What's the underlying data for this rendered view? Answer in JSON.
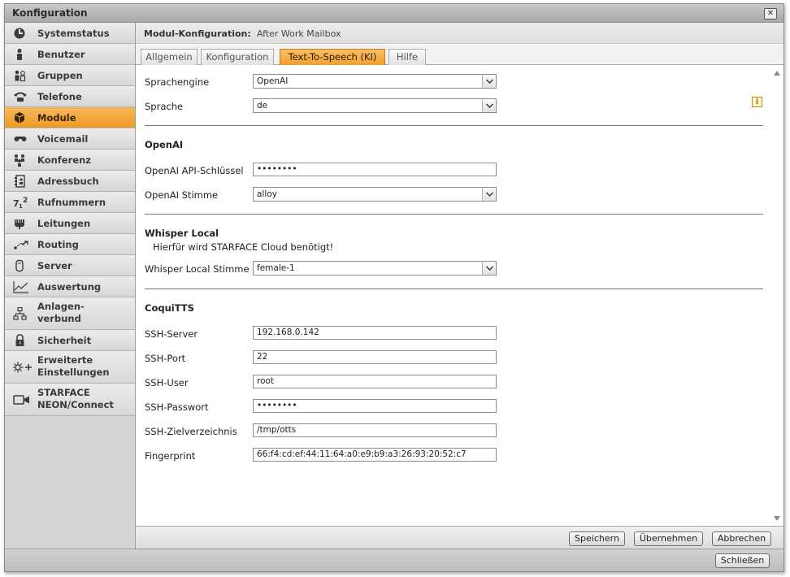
{
  "window": {
    "title": "Konfiguration",
    "close_label": "✕"
  },
  "sidebar": {
    "items": [
      {
        "label": "Systemstatus",
        "icon": "systemstatus-icon"
      },
      {
        "label": "Benutzer",
        "icon": "user-icon"
      },
      {
        "label": "Gruppen",
        "icon": "group-icon"
      },
      {
        "label": "Telefone",
        "icon": "phone-icon"
      },
      {
        "label": "Module",
        "icon": "module-icon",
        "active": true
      },
      {
        "label": "Voicemail",
        "icon": "voicemail-icon"
      },
      {
        "label": "Konferenz",
        "icon": "conference-icon"
      },
      {
        "label": "Adressbuch",
        "icon": "addressbook-icon"
      },
      {
        "label": "Rufnummern",
        "icon": "numbers-icon"
      },
      {
        "label": "Leitungen",
        "icon": "lines-icon"
      },
      {
        "label": "Routing",
        "icon": "routing-icon"
      },
      {
        "label": "Server",
        "icon": "server-icon"
      },
      {
        "label": "Auswertung",
        "icon": "chart-icon"
      },
      {
        "label": "Anlagen-\nverbund",
        "icon": "network-icon"
      },
      {
        "label": "Sicherheit",
        "icon": "lock-icon"
      },
      {
        "label": "Erweiterte\nEinstellungen",
        "icon": "advanced-settings-icon"
      },
      {
        "label": "STARFACE\nNEON/Connect",
        "icon": "video-icon"
      }
    ]
  },
  "header": {
    "title": "Modul-Konfiguration:",
    "module_name": "After Work Mailbox"
  },
  "tabs": [
    {
      "label": "Allgemein"
    },
    {
      "label": "Konfiguration"
    },
    {
      "label": "Text-To-Speech (KI)",
      "active": true
    },
    {
      "label": "Hilfe"
    }
  ],
  "form": {
    "sprachengine": {
      "label": "Sprachengine",
      "value": "OpenAI"
    },
    "sprache": {
      "label": "Sprache",
      "value": "de"
    },
    "openai": {
      "section": "OpenAI",
      "api_key_label": "OpenAI API-Schlüssel",
      "api_key_value": "••••••••",
      "voice_label": "OpenAI Stimme",
      "voice_value": "alloy"
    },
    "whisper": {
      "section": "Whisper Local",
      "note": "Hierfür wird STARFACE Cloud benötigt!",
      "voice_label": "Whisper Local Stimme",
      "voice_value": "female-1"
    },
    "coqui": {
      "section": "CoquiTTS",
      "fields": [
        {
          "label": "SSH-Server",
          "value": "192.168.0.142"
        },
        {
          "label": "SSH-Port",
          "value": "22"
        },
        {
          "label": "SSH-User",
          "value": "root"
        },
        {
          "label": "SSH-Passwort",
          "value": "••••••••"
        },
        {
          "label": "SSH-Zielverzeichnis",
          "value": "/tmp/otts"
        },
        {
          "label": "Fingerprint",
          "value": "66:f4:cd:ef:44:11:64:a0:e9:b9:a3:26:93:20:52:c7"
        }
      ]
    }
  },
  "footer": {
    "save": "Speichern",
    "apply": "Übernehmen",
    "cancel": "Abbrechen"
  },
  "bottombar": {
    "close": "Schließen"
  },
  "colors": {
    "accent": "#f0a030",
    "active_nav": "#ee9a23"
  }
}
